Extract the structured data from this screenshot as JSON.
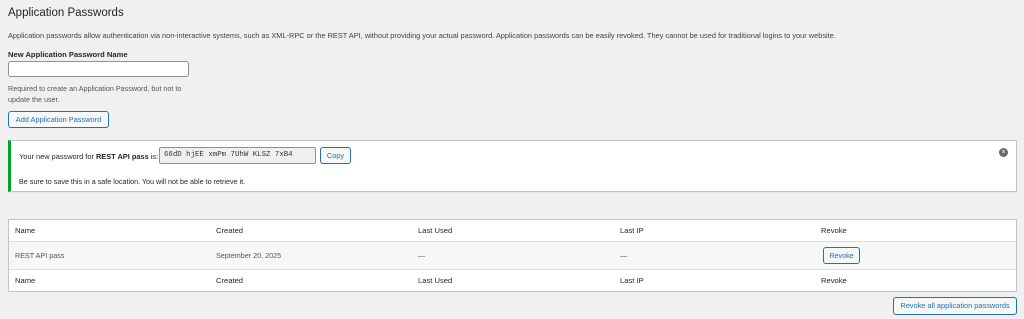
{
  "section": {
    "title": "Application Passwords",
    "description": "Application passwords allow authentication via non-interactive systems, such as XML-RPC or the REST API, without providing your actual password. Application passwords can be easily revoked. They cannot be used for traditional logins to your website."
  },
  "form": {
    "name_label": "New Application Password Name",
    "name_value": "",
    "help_text": "Required to create an Application Password, but not to update the user.",
    "add_button": "Add Application Password"
  },
  "notice": {
    "prefix": "Your new password for ",
    "app_name": "REST API pass",
    "suffix": " is:",
    "password": "66dD hjEE xmPm 7UhW KLSZ 7xB4",
    "copy_button": "Copy",
    "note": "Be sure to save this in a safe location. You will not be able to retrieve it.",
    "dismiss_icon": "x-circle-icon",
    "accent_color": "#00a32a"
  },
  "table": {
    "columns": [
      "Name",
      "Created",
      "Last Used",
      "Last IP",
      "Revoke"
    ],
    "rows": [
      {
        "name": "REST API pass",
        "created": "September 20, 2025",
        "last_used": "—",
        "last_ip": "—",
        "revoke_button": "Revoke"
      }
    ]
  },
  "revoke_all_button": "Revoke all application passwords"
}
